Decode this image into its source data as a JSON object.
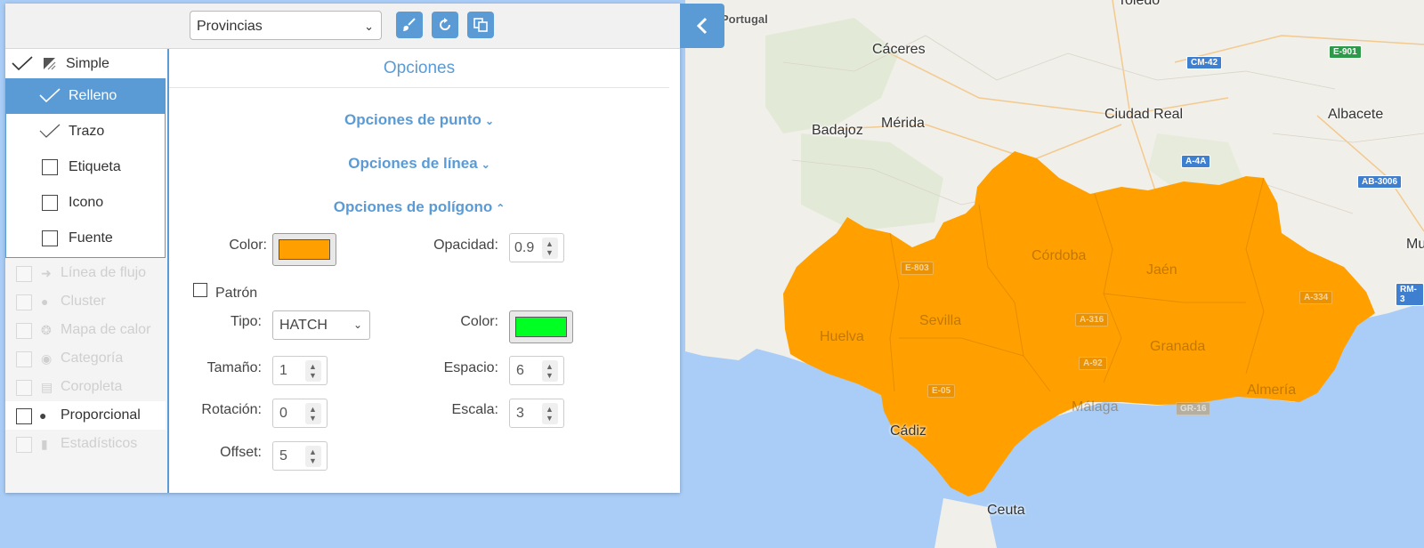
{
  "map": {
    "labels": {
      "portugal": "Portugal",
      "toledo": "Toledo",
      "caceres": "Cáceres",
      "badajoz": "Badajoz",
      "merida": "Mérida",
      "ciudad_real": "Ciudad Real",
      "albacete": "Albacete",
      "mu": "Mu",
      "cordoba": "Córdoba",
      "jaen": "Jaén",
      "sevilla": "Sevilla",
      "huelva": "Huelva",
      "granada": "Granada",
      "malaga": "Málaga",
      "almeria": "Almería",
      "cadiz": "Cádiz",
      "ceuta": "Ceuta"
    },
    "roads": {
      "cm42": "CM-42",
      "e901": "E-901",
      "a4a": "A-4A",
      "ab3006": "AB-3006",
      "rm3": "RM-3",
      "e803": "E-803",
      "a316": "A-316",
      "a92": "A-92",
      "e05": "E-05",
      "gr16": "GR-16",
      "a334": "A-334"
    },
    "region_fill": "#ffa000"
  },
  "toolbar": {
    "layer_select_value": "Provincias",
    "brush_icon": "brush-icon",
    "reset_icon": "reset-icon",
    "copy_icon": "copy-icon",
    "collapse_icon": "chevron-left-icon"
  },
  "sidebar": {
    "simple_label": "Simple",
    "sub_items": [
      {
        "label": "Relleno",
        "state": "checked-active"
      },
      {
        "label": "Trazo",
        "state": "checked"
      },
      {
        "label": "Etiqueta",
        "state": "unchecked"
      },
      {
        "label": "Icono",
        "state": "unchecked"
      },
      {
        "label": "Fuente",
        "state": "unchecked"
      }
    ],
    "types": [
      {
        "label": "Línea de flujo",
        "icon": "arrow-right-icon",
        "enabled": false
      },
      {
        "label": "Cluster",
        "icon": "cluster-icon",
        "enabled": false
      },
      {
        "label": "Mapa de calor",
        "icon": "heatmap-icon",
        "enabled": false
      },
      {
        "label": "Categoría",
        "icon": "category-icon",
        "enabled": false
      },
      {
        "label": "Coropleta",
        "icon": "choropleth-icon",
        "enabled": false
      },
      {
        "label": "Proporcional",
        "icon": "proportional-icon",
        "enabled": true
      },
      {
        "label": "Estadísticos",
        "icon": "bar-chart-icon",
        "enabled": false
      }
    ]
  },
  "main": {
    "title": "Opciones",
    "sections": {
      "point": "Opciones de punto",
      "line": "Opciones de línea",
      "polygon": "Opciones de polígono"
    },
    "polygon": {
      "color_label": "Color:",
      "color_value": "#ffa000",
      "opacity_label": "Opacidad:",
      "opacity_value": "0.9",
      "pattern_label": "Patrón",
      "type_label": "Tipo:",
      "type_value": "HATCH",
      "pattern_color_label": "Color:",
      "pattern_color_value": "#00ff22",
      "size_label": "Tamaño:",
      "size_value": "1",
      "spacing_label": "Espacio:",
      "spacing_value": "6",
      "rotation_label": "Rotación:",
      "rotation_value": "0",
      "scale_label": "Escala:",
      "scale_value": "3",
      "offset_label": "Offset:",
      "offset_value": "5"
    }
  }
}
